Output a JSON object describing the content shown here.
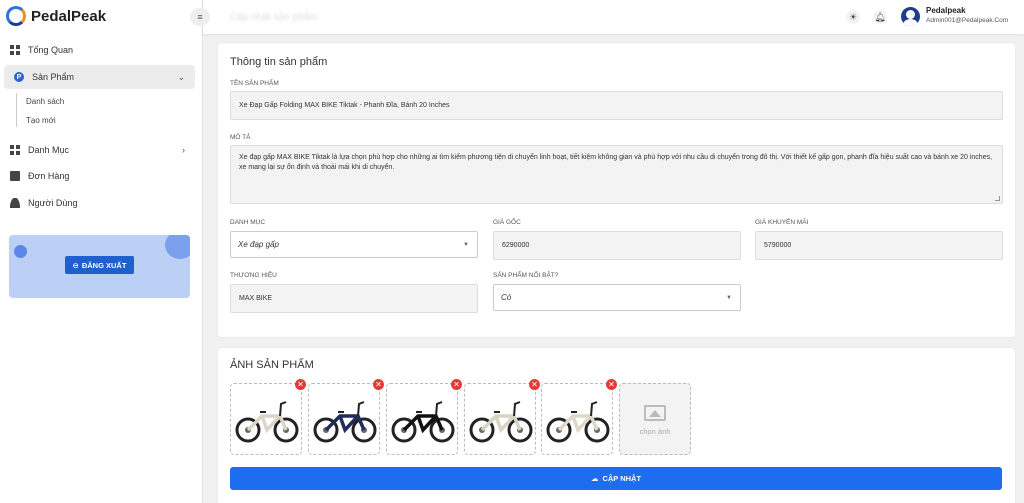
{
  "brand": {
    "name": "PedalPeak"
  },
  "header": {
    "page_title": "Cập nhật sản phẩm",
    "user_name": "Pedalpeak",
    "user_email": "Admin001@Pedalpeak.Com"
  },
  "sidebar": {
    "items": [
      {
        "label": "Tổng Quan",
        "icon": "dashboard-icon"
      },
      {
        "label": "Sản Phẩm",
        "icon": "product-icon",
        "active": true,
        "children": [
          {
            "label": "Danh sách"
          },
          {
            "label": "Tạo mới"
          }
        ]
      },
      {
        "label": "Danh Mục",
        "icon": "category-icon"
      },
      {
        "label": "Đơn Hàng",
        "icon": "order-icon"
      },
      {
        "label": "Người Dùng",
        "icon": "user-icon"
      }
    ],
    "logout_label": "ĐĂNG XUẤT"
  },
  "product_info": {
    "section_title": "Thông tin sản phẩm",
    "name_label": "TÊN SẢN PHẨM",
    "name_value": "Xe Đạp Gấp Folding MAX BIKE Tiktak - Phanh Đĩa, Bánh 20 Inches",
    "desc_label": "MÔ TẢ",
    "desc_value": "Xe đạp gấp MAX BIKE Tiktak là lựa chọn phù hợp cho những ai tìm kiếm phương tiện di chuyển linh hoạt, tiết kiệm không gian và phù hợp với nhu cầu di chuyển trong đô thị. Với thiết kế gấp gọn, phanh đĩa hiệu suất cao và bánh xe 20 inches, xe mang lại sự ổn định và thoải mái khi di chuyển.",
    "category_label": "DANH MỤC",
    "category_value": "Xe đạp gấp",
    "price_label": "GIÁ GỐC",
    "price_value": "6290000",
    "sale_price_label": "GIÁ KHUYẾN MÃI",
    "sale_price_value": "5790000",
    "brand_label": "THƯƠNG HIỆU",
    "brand_value": "MAX BIKE",
    "featured_label": "SẢN PHẨM NỔI BẬT?",
    "featured_value": "Có"
  },
  "images": {
    "section_title": "ẢNH SẢN PHẨM",
    "items": [
      {
        "frame_color": "#d9d6c8"
      },
      {
        "frame_color": "#1f2c5c"
      },
      {
        "frame_color": "#111111"
      },
      {
        "frame_color": "#d7d4c3"
      },
      {
        "frame_color": "#dcd9c8"
      }
    ],
    "add_label": "chọn ảnh"
  },
  "actions": {
    "update_label": "CẬP NHẬT"
  },
  "colors": {
    "primary": "#1e6cf0",
    "danger": "#e53935",
    "card_bg": "#bcd0f5"
  }
}
